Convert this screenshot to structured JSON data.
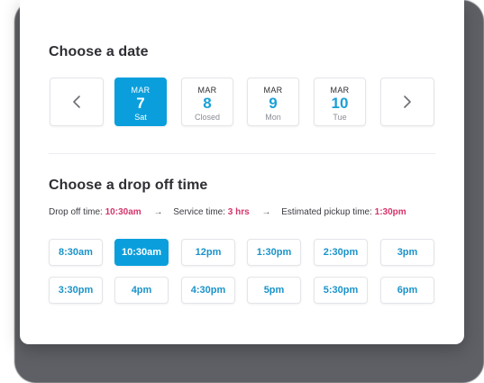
{
  "date_section": {
    "title": "Choose a date",
    "dates": [
      {
        "month": "MAR",
        "day": "7",
        "sub": "Sat",
        "selected": true
      },
      {
        "month": "MAR",
        "day": "8",
        "sub": "Closed",
        "selected": false
      },
      {
        "month": "MAR",
        "day": "9",
        "sub": "Mon",
        "selected": false
      },
      {
        "month": "MAR",
        "day": "10",
        "sub": "Tue",
        "selected": false
      }
    ],
    "prev_icon": "chevron-left-icon",
    "next_icon": "chevron-right-icon"
  },
  "time_section": {
    "title": "Choose a drop off time",
    "summary": {
      "drop_off_label": "Drop off time:",
      "drop_off_value": "10:30am",
      "service_label": "Service time:",
      "service_value": "3 hrs",
      "pickup_label": "Estimated pickup time:",
      "pickup_value": "1:30pm",
      "arrow_icon": "arrow-right-icon"
    },
    "slots": [
      {
        "label": "8:30am",
        "selected": false
      },
      {
        "label": "10:30am",
        "selected": true
      },
      {
        "label": "12pm",
        "selected": false
      },
      {
        "label": "1:30pm",
        "selected": false
      },
      {
        "label": "2:30pm",
        "selected": false
      },
      {
        "label": "3pm",
        "selected": false
      },
      {
        "label": "3:30pm",
        "selected": false
      },
      {
        "label": "4pm",
        "selected": false
      },
      {
        "label": "4:30pm",
        "selected": false
      },
      {
        "label": "5pm",
        "selected": false
      },
      {
        "label": "5:30pm",
        "selected": false
      },
      {
        "label": "6pm",
        "selected": false
      }
    ]
  },
  "colors": {
    "accent": "#0a9fdc",
    "highlight": "#d6336c",
    "text": "#2e2e34"
  }
}
